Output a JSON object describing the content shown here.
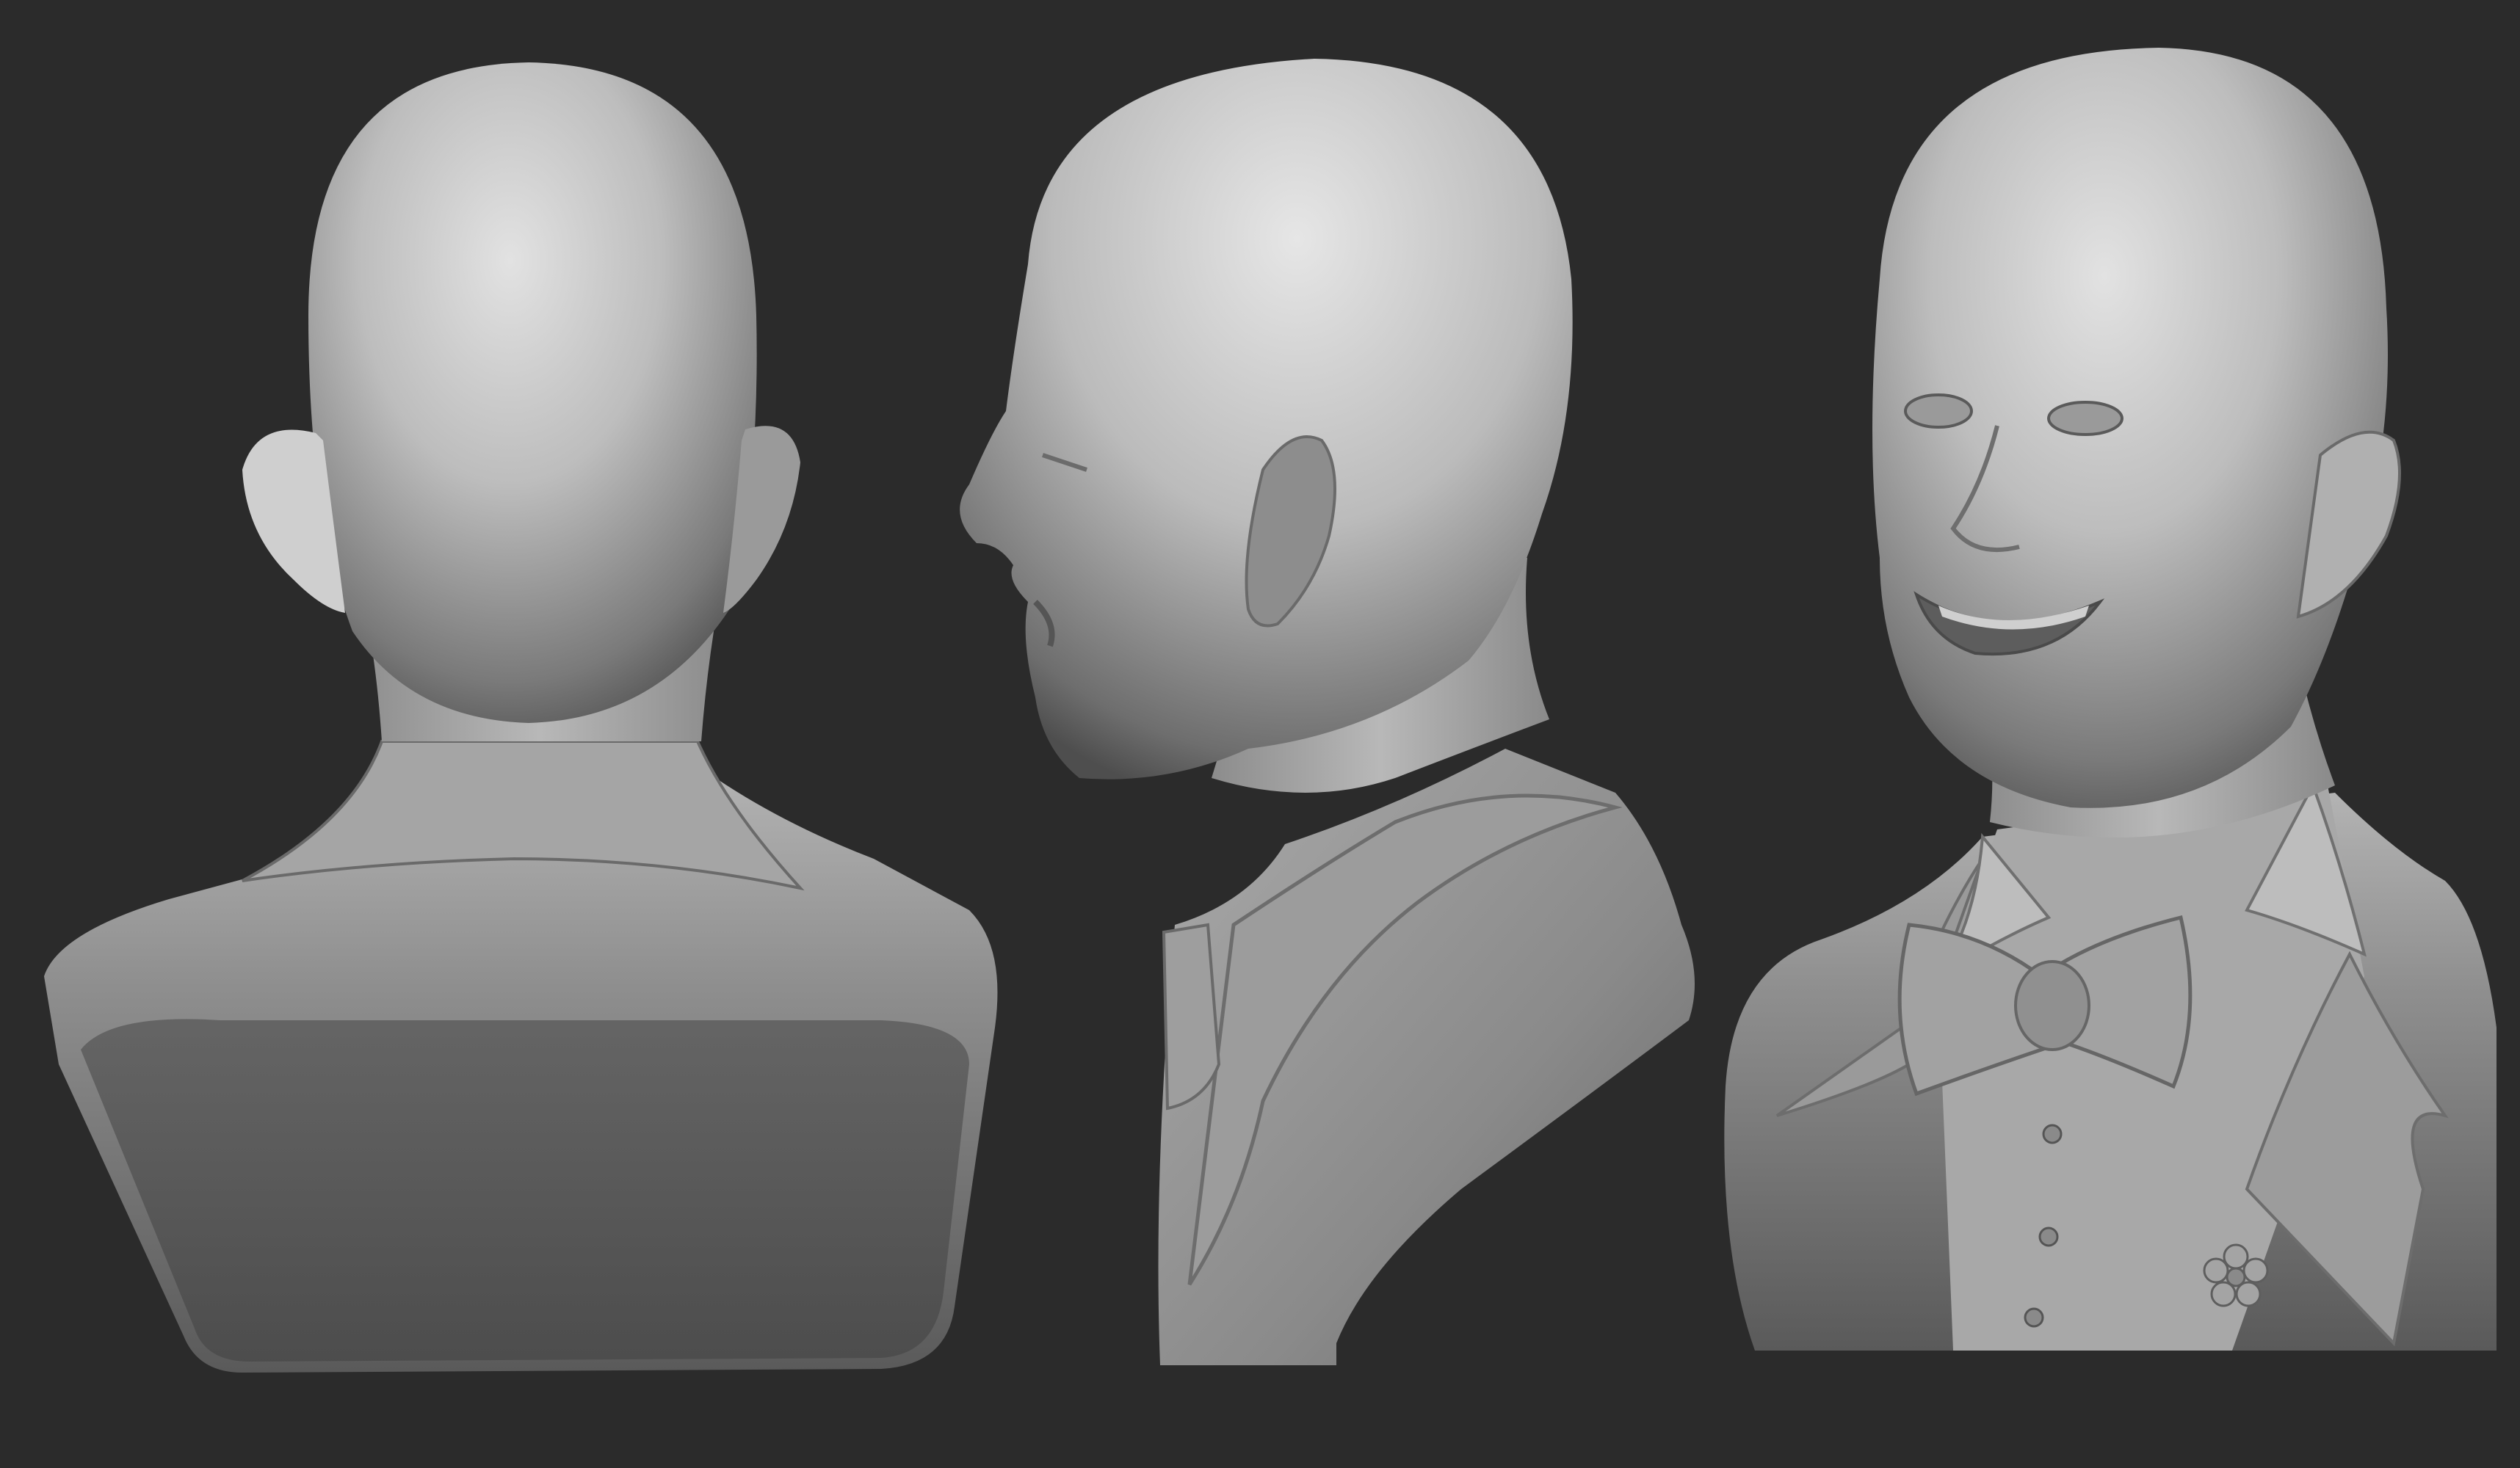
{
  "scene": {
    "background_color": "#2b2b2b",
    "material_color": "#9a9a9a",
    "views": [
      {
        "id": "back",
        "label": ""
      },
      {
        "id": "side",
        "label": ""
      },
      {
        "id": "three-quarter",
        "label": ""
      }
    ]
  }
}
